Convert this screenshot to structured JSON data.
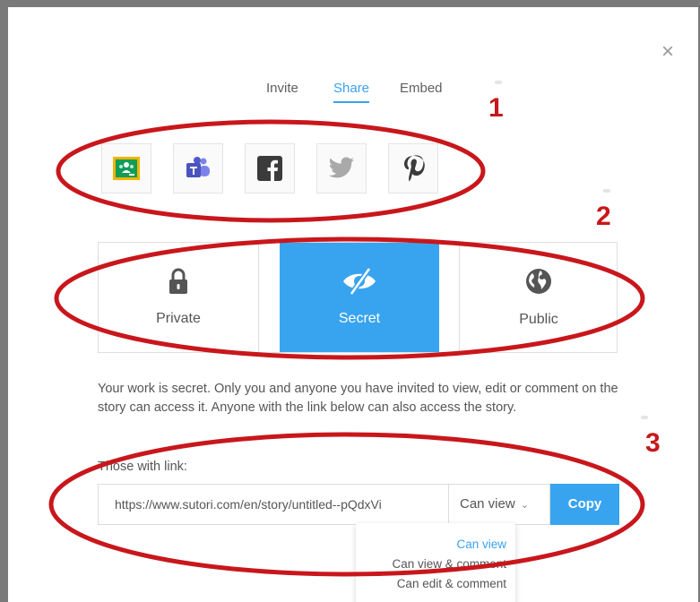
{
  "modal": {
    "close_glyph": "×"
  },
  "tabs": [
    {
      "label": "Invite",
      "active": false
    },
    {
      "label": "Share",
      "active": true
    },
    {
      "label": "Embed",
      "active": false
    }
  ],
  "share_buttons": [
    {
      "name": "google-classroom",
      "icon": "google-classroom-icon"
    },
    {
      "name": "microsoft-teams",
      "icon": "teams-icon"
    },
    {
      "name": "facebook",
      "icon": "facebook-icon"
    },
    {
      "name": "twitter",
      "icon": "twitter-icon"
    },
    {
      "name": "pinterest",
      "icon": "pinterest-icon"
    }
  ],
  "visibility": {
    "selected": "Secret",
    "options": [
      {
        "label": "Private",
        "icon": "lock-icon"
      },
      {
        "label": "Secret",
        "icon": "eye-slash-icon"
      },
      {
        "label": "Public",
        "icon": "globe-icon"
      }
    ]
  },
  "description": "Your work is secret. Only you and anyone you have invited to view, edit or comment on the story can access it. Anyone with the link below can also access the story.",
  "link": {
    "label": "Those with link:",
    "url": "https://www.sutori.com/en/story/untitled--pQdxVi",
    "permission": "Can view",
    "copy_label": "Copy"
  },
  "permission_options": [
    "Can view",
    "Can view & comment",
    "Can edit & comment"
  ],
  "annotations": {
    "markers": [
      "1",
      "2",
      "3"
    ],
    "color": "#c8171c"
  },
  "colors": {
    "accent": "#38a4f0",
    "annotation": "#c8171c"
  }
}
